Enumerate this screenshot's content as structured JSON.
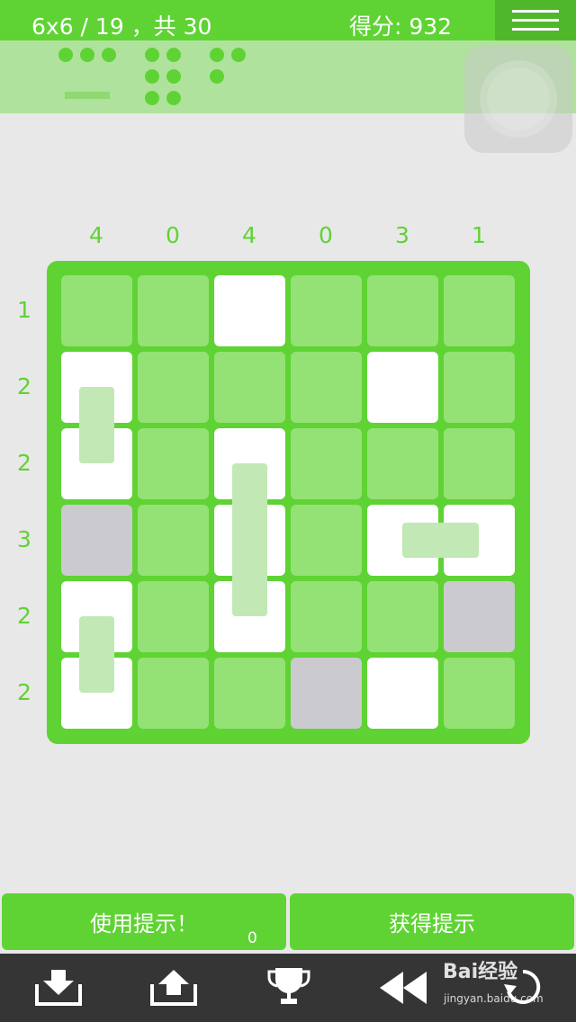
{
  "header": {
    "level_text": "6x6 / 19 ，共 30",
    "score_text": "得分: 932"
  },
  "board": {
    "col_hints": [
      "4",
      "0",
      "4",
      "0",
      "3",
      "1"
    ],
    "row_hints": [
      "1",
      "2",
      "2",
      "3",
      "2",
      "2"
    ],
    "cells": [
      [
        "empty",
        "empty",
        "white-dot",
        "empty",
        "empty",
        "empty"
      ],
      [
        "white-dot",
        "empty",
        "empty",
        "empty",
        "white-graydot",
        "empty"
      ],
      [
        "white-dot",
        "empty",
        "white-graydot",
        "empty",
        "empty",
        "empty"
      ],
      [
        "gray",
        "empty",
        "white-dot",
        "empty",
        "white-dot",
        "white-dot"
      ],
      [
        "white-dot",
        "empty",
        "white-dot",
        "empty",
        "empty",
        "gray"
      ],
      [
        "white-dot",
        "empty",
        "empty",
        "gray",
        "white-dot",
        "empty"
      ]
    ]
  },
  "buttons": {
    "use_hint": "使用提示！",
    "use_hint_count": "0",
    "get_hints": "获得提示"
  },
  "toolbar": {
    "icons": [
      "download-icon",
      "upload-icon",
      "trophy-icon",
      "rewind-icon",
      "undo-icon"
    ]
  },
  "watermark": {
    "brand": "Bai经验",
    "url": "jingyan.baidu.com"
  },
  "colors": {
    "accent": "#5fd334",
    "cell_empty": "#94e275",
    "cell_gray": "#cbcbcf",
    "toolbar_bg": "#353535"
  }
}
